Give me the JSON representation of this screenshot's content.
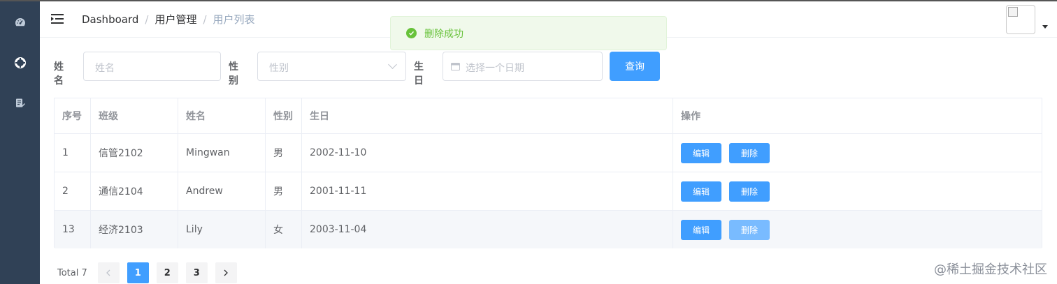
{
  "sidebar": {
    "items": [
      {
        "icon": "dashboard-icon"
      },
      {
        "icon": "life-ring-icon"
      },
      {
        "icon": "document-edit-icon"
      }
    ]
  },
  "navbar": {
    "breadcrumb": [
      "Dashboard",
      "用户管理",
      "用户列表"
    ]
  },
  "toast": {
    "message": "删除成功",
    "type": "success"
  },
  "search_form": {
    "name_label": "姓名",
    "name_placeholder": "姓名",
    "gender_label": "性别",
    "gender_placeholder": "性别",
    "birthday_label": "生日",
    "birthday_placeholder": "选择一个日期",
    "query_button": "查询"
  },
  "table": {
    "headers": [
      "序号",
      "班级",
      "姓名",
      "性别",
      "生日",
      "操作"
    ],
    "rows": [
      {
        "id": "1",
        "class": "信管2102",
        "name": "Mingwan",
        "gender": "男",
        "birthday": "2002-11-10"
      },
      {
        "id": "2",
        "class": "通信2104",
        "name": "Andrew",
        "gender": "男",
        "birthday": "2001-11-11"
      },
      {
        "id": "13",
        "class": "经济2103",
        "name": "Lily",
        "gender": "女",
        "birthday": "2003-11-04"
      }
    ],
    "edit_label": "编辑",
    "delete_label": "删除"
  },
  "pagination": {
    "total": "Total 7",
    "pages": [
      "1",
      "2",
      "3"
    ],
    "current": "1"
  },
  "watermark": "@稀土掘金技术社区",
  "colors": {
    "primary": "#409eff",
    "sidebar": "#304156",
    "success": "#67c23a"
  }
}
